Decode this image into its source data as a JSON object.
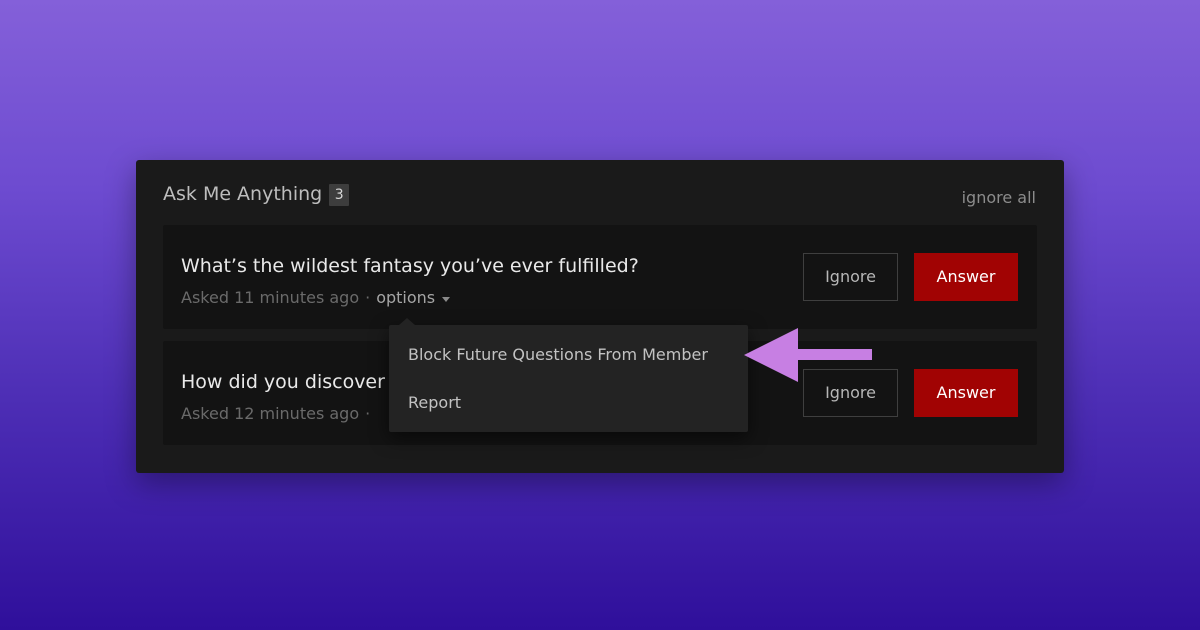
{
  "panel": {
    "title": "Ask Me Anything",
    "count": "3",
    "ignore_all_label": "ignore all"
  },
  "questions": [
    {
      "text": "What’s the wildest fantasy you’ve ever fulfilled?",
      "asked": "Asked 11 minutes ago",
      "separator": "·",
      "options_label": "options",
      "ignore_label": "Ignore",
      "answer_label": "Answer"
    },
    {
      "text": "How did you discover",
      "asked": "Asked 12 minutes ago",
      "separator": "·",
      "ignore_label": "Ignore",
      "answer_label": "Answer"
    }
  ],
  "options_menu": {
    "items": [
      "Block Future Questions From Member",
      "Report"
    ]
  },
  "icons": {
    "options_caret": "caret-down-icon",
    "annotation": "arrow-left-icon"
  },
  "colors": {
    "answer_button": "#a10303",
    "annotation_arrow": "#c77fe3",
    "panel_background": "#1a1a1a"
  }
}
